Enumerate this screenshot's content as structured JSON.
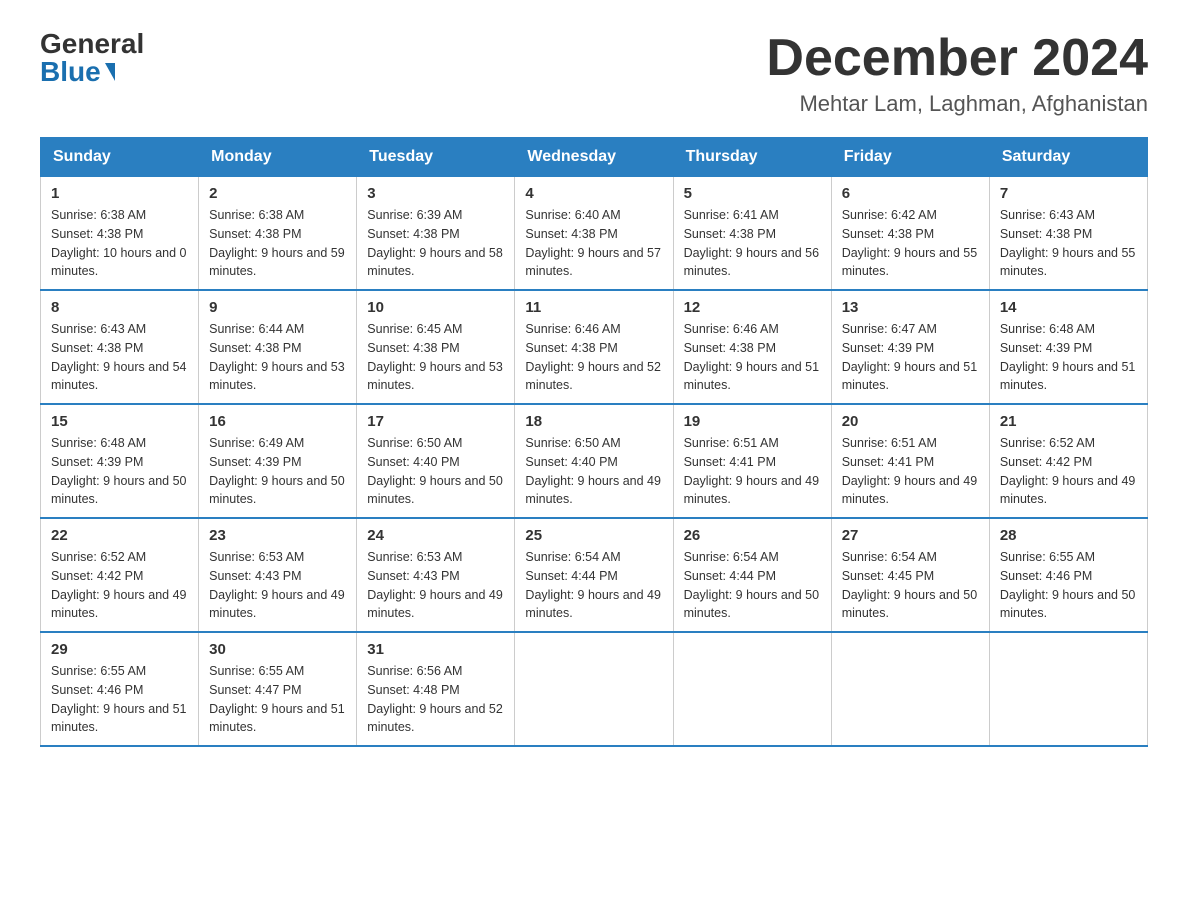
{
  "header": {
    "logo_general": "General",
    "logo_blue": "Blue",
    "month_year": "December 2024",
    "location": "Mehtar Lam, Laghman, Afghanistan"
  },
  "days_of_week": [
    "Sunday",
    "Monday",
    "Tuesday",
    "Wednesday",
    "Thursday",
    "Friday",
    "Saturday"
  ],
  "weeks": [
    [
      {
        "day": "1",
        "sunrise": "6:38 AM",
        "sunset": "4:38 PM",
        "daylight": "10 hours and 0 minutes."
      },
      {
        "day": "2",
        "sunrise": "6:38 AM",
        "sunset": "4:38 PM",
        "daylight": "9 hours and 59 minutes."
      },
      {
        "day": "3",
        "sunrise": "6:39 AM",
        "sunset": "4:38 PM",
        "daylight": "9 hours and 58 minutes."
      },
      {
        "day": "4",
        "sunrise": "6:40 AM",
        "sunset": "4:38 PM",
        "daylight": "9 hours and 57 minutes."
      },
      {
        "day": "5",
        "sunrise": "6:41 AM",
        "sunset": "4:38 PM",
        "daylight": "9 hours and 56 minutes."
      },
      {
        "day": "6",
        "sunrise": "6:42 AM",
        "sunset": "4:38 PM",
        "daylight": "9 hours and 55 minutes."
      },
      {
        "day": "7",
        "sunrise": "6:43 AM",
        "sunset": "4:38 PM",
        "daylight": "9 hours and 55 minutes."
      }
    ],
    [
      {
        "day": "8",
        "sunrise": "6:43 AM",
        "sunset": "4:38 PM",
        "daylight": "9 hours and 54 minutes."
      },
      {
        "day": "9",
        "sunrise": "6:44 AM",
        "sunset": "4:38 PM",
        "daylight": "9 hours and 53 minutes."
      },
      {
        "day": "10",
        "sunrise": "6:45 AM",
        "sunset": "4:38 PM",
        "daylight": "9 hours and 53 minutes."
      },
      {
        "day": "11",
        "sunrise": "6:46 AM",
        "sunset": "4:38 PM",
        "daylight": "9 hours and 52 minutes."
      },
      {
        "day": "12",
        "sunrise": "6:46 AM",
        "sunset": "4:38 PM",
        "daylight": "9 hours and 51 minutes."
      },
      {
        "day": "13",
        "sunrise": "6:47 AM",
        "sunset": "4:39 PM",
        "daylight": "9 hours and 51 minutes."
      },
      {
        "day": "14",
        "sunrise": "6:48 AM",
        "sunset": "4:39 PM",
        "daylight": "9 hours and 51 minutes."
      }
    ],
    [
      {
        "day": "15",
        "sunrise": "6:48 AM",
        "sunset": "4:39 PM",
        "daylight": "9 hours and 50 minutes."
      },
      {
        "day": "16",
        "sunrise": "6:49 AM",
        "sunset": "4:39 PM",
        "daylight": "9 hours and 50 minutes."
      },
      {
        "day": "17",
        "sunrise": "6:50 AM",
        "sunset": "4:40 PM",
        "daylight": "9 hours and 50 minutes."
      },
      {
        "day": "18",
        "sunrise": "6:50 AM",
        "sunset": "4:40 PM",
        "daylight": "9 hours and 49 minutes."
      },
      {
        "day": "19",
        "sunrise": "6:51 AM",
        "sunset": "4:41 PM",
        "daylight": "9 hours and 49 minutes."
      },
      {
        "day": "20",
        "sunrise": "6:51 AM",
        "sunset": "4:41 PM",
        "daylight": "9 hours and 49 minutes."
      },
      {
        "day": "21",
        "sunrise": "6:52 AM",
        "sunset": "4:42 PM",
        "daylight": "9 hours and 49 minutes."
      }
    ],
    [
      {
        "day": "22",
        "sunrise": "6:52 AM",
        "sunset": "4:42 PM",
        "daylight": "9 hours and 49 minutes."
      },
      {
        "day": "23",
        "sunrise": "6:53 AM",
        "sunset": "4:43 PM",
        "daylight": "9 hours and 49 minutes."
      },
      {
        "day": "24",
        "sunrise": "6:53 AM",
        "sunset": "4:43 PM",
        "daylight": "9 hours and 49 minutes."
      },
      {
        "day": "25",
        "sunrise": "6:54 AM",
        "sunset": "4:44 PM",
        "daylight": "9 hours and 49 minutes."
      },
      {
        "day": "26",
        "sunrise": "6:54 AM",
        "sunset": "4:44 PM",
        "daylight": "9 hours and 50 minutes."
      },
      {
        "day": "27",
        "sunrise": "6:54 AM",
        "sunset": "4:45 PM",
        "daylight": "9 hours and 50 minutes."
      },
      {
        "day": "28",
        "sunrise": "6:55 AM",
        "sunset": "4:46 PM",
        "daylight": "9 hours and 50 minutes."
      }
    ],
    [
      {
        "day": "29",
        "sunrise": "6:55 AM",
        "sunset": "4:46 PM",
        "daylight": "9 hours and 51 minutes."
      },
      {
        "day": "30",
        "sunrise": "6:55 AM",
        "sunset": "4:47 PM",
        "daylight": "9 hours and 51 minutes."
      },
      {
        "day": "31",
        "sunrise": "6:56 AM",
        "sunset": "4:48 PM",
        "daylight": "9 hours and 52 minutes."
      },
      null,
      null,
      null,
      null
    ]
  ]
}
